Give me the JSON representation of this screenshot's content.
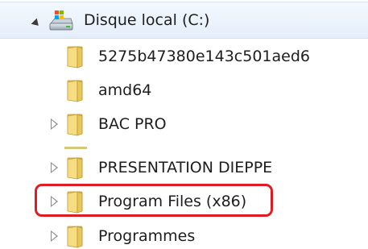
{
  "tree": {
    "root": {
      "label": "Disque local (C:)",
      "icon": "hard-drive-icon",
      "expanded": true
    },
    "children": [
      {
        "label": "5275b47380e143c501aed6",
        "icon": "folder-icon",
        "has_children": false
      },
      {
        "label": "amd64",
        "icon": "folder-icon",
        "has_children": false
      },
      {
        "label": "BAC PRO",
        "icon": "folder-icon",
        "has_children": true
      },
      {
        "label": "PRESENTATION DIEPPE",
        "icon": "folder-icon",
        "has_children": true
      },
      {
        "label": "Program Files (x86)",
        "icon": "folder-icon",
        "has_children": true,
        "highlighted": true
      },
      {
        "label": "Programmes",
        "icon": "folder-icon",
        "has_children": true
      }
    ]
  },
  "colors": {
    "highlight_border": "#e01b22",
    "root_row_bg": "#e4eefb",
    "folder_yellow": "#f3d46b"
  }
}
